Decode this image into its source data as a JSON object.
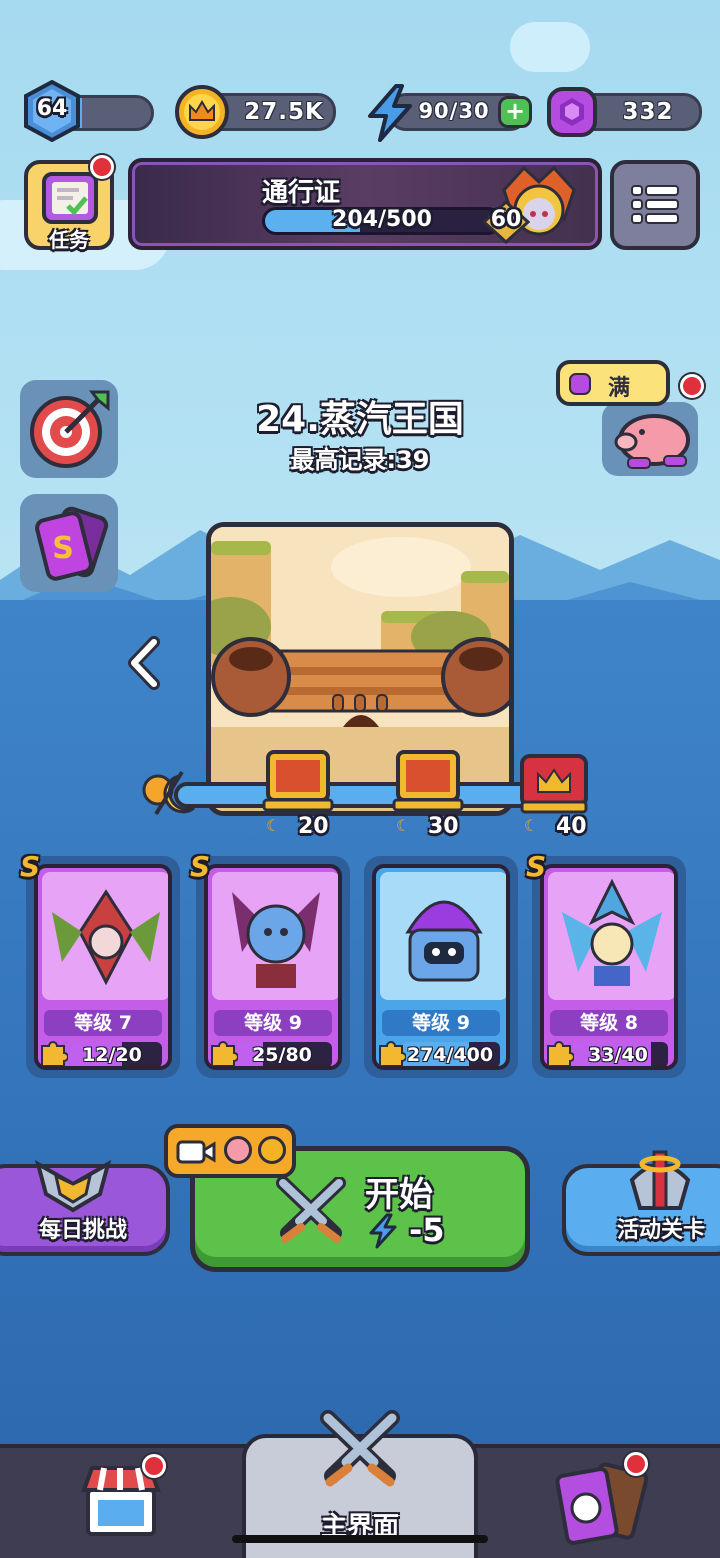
{
  "player": {
    "level": "64",
    "level_progress": 0.25
  },
  "resources": {
    "gold": "27.5K",
    "energy": "90/30",
    "gems": "332"
  },
  "tasks_button": {
    "label": "任务"
  },
  "battle_pass": {
    "title": "通行证",
    "progress_text": "204/500",
    "progress": 0.408,
    "tier": "60"
  },
  "piggy_bank": {
    "label": "满"
  },
  "stage": {
    "name": "24.蒸汽王国",
    "record": "最高记录:39"
  },
  "rewards": [
    {
      "label": "20"
    },
    {
      "label": "30"
    },
    {
      "label": "40"
    }
  ],
  "heroes": [
    {
      "rank": "S",
      "level": "等级 7",
      "progress_text": "12/20",
      "progress": 0.6,
      "theme": "purple"
    },
    {
      "rank": "S",
      "level": "等级 9",
      "progress_text": "25/80",
      "progress": 0.3125,
      "theme": "purple"
    },
    {
      "rank": "",
      "level": "等级 9",
      "progress_text": "274/400",
      "progress": 0.685,
      "theme": "blue"
    },
    {
      "rank": "S",
      "level": "等级 8",
      "progress_text": "33/40",
      "progress": 0.825,
      "theme": "purple"
    }
  ],
  "actions": {
    "daily": "每日挑战",
    "start": "开始",
    "start_cost": "-5",
    "event": "活动关卡"
  },
  "nav": {
    "main": "主界面"
  },
  "colors": {
    "purple_card": "#c45de8",
    "blue_card": "#4aa6e8",
    "green_button": "#5cc24a",
    "gold": "#f5b72a"
  }
}
